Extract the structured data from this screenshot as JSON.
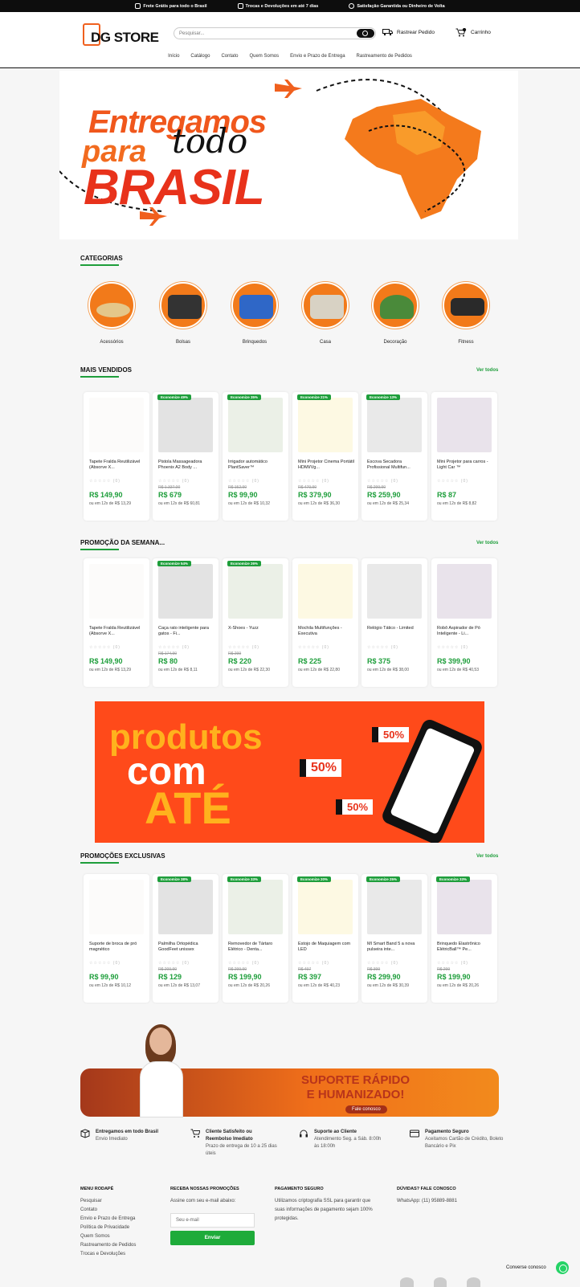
{
  "topbar": {
    "items": [
      {
        "icon": "box-icon",
        "text": "Frete Grátis para todo o Brasil"
      },
      {
        "icon": "truck-return-icon",
        "text": "Trocas e Devoluções em até 7 dias"
      },
      {
        "icon": "heart-icon",
        "text": "Satisfação Garantida ou Dinheiro de Volta"
      }
    ]
  },
  "header": {
    "logo_text": "DG STORE",
    "search_placeholder": "Pesquisar...",
    "track_label": "Rastrear Pedido",
    "cart_label": "Carrinho",
    "cart_count": "0"
  },
  "nav": [
    "Início",
    "Catálogo",
    "Contato",
    "Quem Somos",
    "Envio e Prazo de Entrega",
    "Rastreamento de Pedidos"
  ],
  "hero": {
    "line1": "Entregamos",
    "line2": "para",
    "script": "todo",
    "line3": "BRASIL"
  },
  "categories": {
    "title": "CATEGORIAS",
    "items": [
      "Acessórios",
      "Bolsas",
      "Brinquedos",
      "Casa",
      "Decoração",
      "Fitness"
    ]
  },
  "bestsellers": {
    "title": "MAIS VENDIDOS",
    "see_all": "Ver todos",
    "products": [
      {
        "badge": "",
        "name": "Tapete Fralda Reutilizável (Absorve X...",
        "stars": "☆☆☆☆☆ (0)",
        "old": "",
        "price": "R$ 149,90",
        "inst": "ou em 12x de R$ 13,29"
      },
      {
        "badge": "Economize 49%",
        "name": "Pistola Massageadora Phoenix A2 Body ...",
        "stars": "☆☆☆☆☆ (0)",
        "old": "R$ 1.337,00",
        "price": "R$ 679",
        "inst": "ou em 12x de R$ 60,81"
      },
      {
        "badge": "Economize 35%",
        "name": "Irrigador automático PlantSaver™",
        "stars": "☆☆☆☆☆ (0)",
        "old": "R$ 152,90",
        "price": "R$ 99,90",
        "inst": "ou em 12x de R$ 10,32"
      },
      {
        "badge": "Economize 21%",
        "name": "Mini Projetor Cinema Portátil HDMI/Vg...",
        "stars": "☆☆☆☆☆ (0)",
        "old": "R$ 479,90",
        "price": "R$ 379,90",
        "inst": "ou em 12x de R$ 36,30"
      },
      {
        "badge": "Economize 13%",
        "name": "Escova Secadora Profissional Multifun...",
        "stars": "☆☆☆☆☆ (0)",
        "old": "R$ 299,90",
        "price": "R$ 259,90",
        "inst": "ou em 12x de R$ 25,34"
      },
      {
        "badge": "",
        "name": "Mini Projetor para carros - Light Car ™",
        "stars": "☆☆☆☆☆ (0)",
        "old": "",
        "price": "R$ 87",
        "inst": "ou em 12x de R$ 8,82"
      }
    ]
  },
  "weekpromo": {
    "title": "PROMOÇÃO DA SEMANA...",
    "see_all": "Ver todos",
    "products": [
      {
        "badge": "",
        "name": "Tapete Fralda Reutilizável (Absorve X...",
        "stars": "☆☆☆☆☆ (0)",
        "old": "",
        "price": "R$ 149,90",
        "inst": "ou em 12x de R$ 13,29"
      },
      {
        "badge": "Economize 54%",
        "name": "Caça rato inteligente para gatos - Fi...",
        "stars": "☆☆☆☆☆ (0)",
        "old": "R$ 174,90",
        "price": "R$ 80",
        "inst": "ou em 12x de R$ 8,11"
      },
      {
        "badge": "Economize 26%",
        "name": "X-Shoes - Yuzz",
        "stars": "☆☆☆☆☆ (0)",
        "old": "R$ 299",
        "price": "R$ 220",
        "inst": "ou em 12x de R$ 22,30"
      },
      {
        "badge": "",
        "name": "Mochila Multifunções - Executiva",
        "stars": "☆☆☆☆☆ (0)",
        "old": "",
        "price": "R$ 225",
        "inst": "ou em 12x de R$ 22,80"
      },
      {
        "badge": "",
        "name": "Relógio Tático - Limited",
        "stars": "☆☆☆☆☆ (0)",
        "old": "",
        "price": "R$ 375",
        "inst": "ou em 12x de R$ 38,00"
      },
      {
        "badge": "",
        "name": "Robô Aspirador de Pó Inteligente - Li...",
        "stars": "☆☆☆☆☆ (0)",
        "old": "",
        "price": "R$ 399,90",
        "inst": "ou em 12x de R$ 40,53"
      }
    ]
  },
  "promo_banner": {
    "l1": "produtos",
    "l2": "com",
    "l3": "ATÉ",
    "tickets": [
      "50%",
      "50%",
      "50%"
    ]
  },
  "exclusive": {
    "title": "PROMOÇÕES EXCLUSIVAS",
    "see_all": "Ver todos",
    "products": [
      {
        "badge": "",
        "name": "Suporte de broca de pró magnético",
        "stars": "☆☆☆☆☆ (0)",
        "old": "",
        "price": "R$ 99,90",
        "inst": "ou em 12x de R$ 10,12"
      },
      {
        "badge": "Economize 38%",
        "name": "Palmilha Ortopédica GoodFeet unissex",
        "stars": "☆☆☆☆☆ (0)",
        "old": "R$ 209,90",
        "price": "R$ 129",
        "inst": "ou em 12x de R$ 13,07"
      },
      {
        "badge": "Economize 33%",
        "name": "Removedor de Tártaro Elétrico - Denta...",
        "stars": "☆☆☆☆☆ (0)",
        "old": "R$ 299,90",
        "price": "R$ 199,90",
        "inst": "ou em 12x de R$ 20,26"
      },
      {
        "badge": "Economize 20%",
        "name": "Estojo de Maquiagem com LED",
        "stars": "☆☆☆☆☆ (0)",
        "old": "R$ 497",
        "price": "R$ 397",
        "inst": "ou em 12x de R$ 40,23"
      },
      {
        "badge": "Economize 25%",
        "name": "MI Smart Band 5 a nova pulseira inte...",
        "stars": "☆☆☆☆☆ (0)",
        "old": "R$ 399",
        "price": "R$ 299,90",
        "inst": "ou em 12x de R$ 30,39"
      },
      {
        "badge": "Economize 33%",
        "name": "Brinquedo Elastrônico ElétricBall™ Pe...",
        "stars": "☆☆☆☆☆ (0)",
        "old": "R$ 299",
        "price": "R$ 199,90",
        "inst": "ou em 12x de R$ 20,26"
      }
    ]
  },
  "support": {
    "title_l1": "SUPORTE RÁPIDO",
    "title_l2": "E HUMANIZADO!",
    "button": "Fale conosco"
  },
  "features": [
    {
      "icon": "box-icon",
      "title": "Entregamos em todo Brasil",
      "sub": "Envio Imediato"
    },
    {
      "icon": "cart-icon",
      "title": "Cliente Satisfeito ou Reembolso Imediato",
      "sub": "Prazo de entrega de 10 a 25 dias úteis"
    },
    {
      "icon": "headset-icon",
      "title": "Suporte ao Cliente",
      "sub": "Atendimento Seg. a Sáb. 8:00h às 18:00h"
    },
    {
      "icon": "card-icon",
      "title": "Pagamento Seguro",
      "sub": "Aceitamos Cartão de Crédito, Boleto Bancário e Pix"
    }
  ],
  "footer": {
    "menu_title": "MENU RODAPÉ",
    "menu": [
      "Pesquisar",
      "Contato",
      "Envio e Prazo de Entrega",
      "Política de Privacidade",
      "Quem Somos",
      "Rastreamento de Pedidos",
      "Trocas e Devoluções"
    ],
    "news_title": "RECEBA NOSSAS PROMOÇÕES",
    "news_text": "Assine com seu e-mail abaixo:",
    "email_placeholder": "Seu e-mail",
    "send": "Enviar",
    "pay_title": "PAGAMENTO SEGURO",
    "pay_text": "Utilizamos criptografia SSL para garantir que suas informações de pagamento sejam 100% protegidas.",
    "help_title": "DÚVIDAS? FALE CONOSCO",
    "help_text": "WhatsApp: (11) 95889-8881"
  },
  "whatsapp": {
    "label": "Converse conosco"
  }
}
